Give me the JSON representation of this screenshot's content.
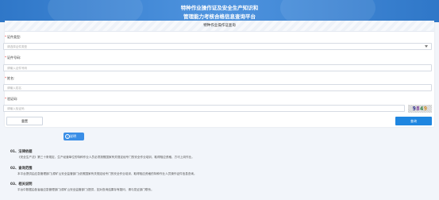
{
  "header": {
    "title_line1": "特种作业操作证及安全生产知识和",
    "title_line2": "管理能力考核合格信息查询平台"
  },
  "form": {
    "title": "特种作业操作证查询",
    "cert_type": {
      "label": "证件类型:",
      "placeholder": "请选择证件类型"
    },
    "cert_number": {
      "label": "证件号码:",
      "placeholder": "请输入证件号码"
    },
    "name": {
      "label": "姓名:",
      "placeholder": "请输入姓名"
    },
    "captcha": {
      "label": "验证码:",
      "placeholder": "请输入验证码",
      "code": "9849"
    },
    "reset_label": "重置",
    "query_label": "查询"
  },
  "notes": {
    "button_label": "说明",
    "sections": [
      {
        "heading": "01、法律依据",
        "text": "《安全生产法》第三十条规定，生产经营单位的特种作业人员必须按照国家有关规定经专门的安全作业培训，取得相应资格，方可上岗作业。"
      },
      {
        "heading": "02、查询范围",
        "text": "本平台提供由应急管理部门(原矿山安全监管部门)依照国家有关规定经专门的安全作业培训、取得相应资格的特种作业人员操作证件信息查询。"
      },
      {
        "heading": "03、相关说明",
        "text": "平台中数据由各省级应急管理部门(原矿山安全监管部门)提供，如对查询结果存有疑问，请与发证部门联系。"
      }
    ]
  },
  "colors": {
    "header_blue": "#2f77c8",
    "primary_button": "#1f86e0",
    "required_star": "#e33333",
    "captcha_digits": [
      "#2a2a8a",
      "#7a3a9a",
      "#2a7a3a",
      "#d08a20"
    ]
  }
}
